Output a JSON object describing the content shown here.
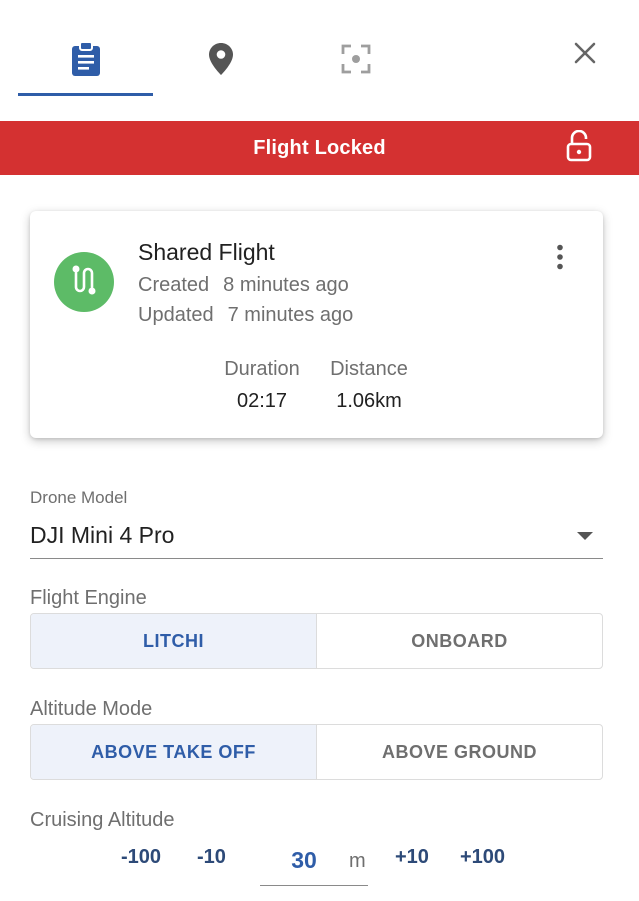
{
  "tabs": [
    {
      "icon": "clipboard-icon",
      "active": true
    },
    {
      "icon": "map-pin-icon",
      "active": false
    },
    {
      "icon": "focus-target-icon",
      "active": false
    }
  ],
  "banner": {
    "text": "Flight Locked",
    "color": "#d43131",
    "icon": "lock-open-icon"
  },
  "card": {
    "title": "Shared Flight",
    "created_label": "Created",
    "created_value": "8 minutes ago",
    "updated_label": "Updated",
    "updated_value": "7 minutes ago",
    "duration_label": "Duration",
    "duration_value": "02:17",
    "distance_label": "Distance",
    "distance_value": "1.06km",
    "avatar_icon": "route-icon",
    "avatar_color": "#5dbb67"
  },
  "drone_model": {
    "label": "Drone Model",
    "value": "DJI Mini 4 Pro"
  },
  "flight_engine": {
    "label": "Flight Engine",
    "options": [
      "LITCHI",
      "ONBOARD"
    ],
    "selected": "LITCHI"
  },
  "altitude_mode": {
    "label": "Altitude Mode",
    "options": [
      "ABOVE TAKE OFF",
      "ABOVE GROUND"
    ],
    "selected": "ABOVE TAKE OFF"
  },
  "cruising_altitude": {
    "label": "Cruising Altitude",
    "minus100": "-100",
    "minus10": "-10",
    "value": "30",
    "unit": "m",
    "plus10": "+10",
    "plus100": "+100"
  },
  "colors": {
    "accent": "#2f5da8",
    "danger": "#d43131",
    "success": "#5dbb67"
  }
}
